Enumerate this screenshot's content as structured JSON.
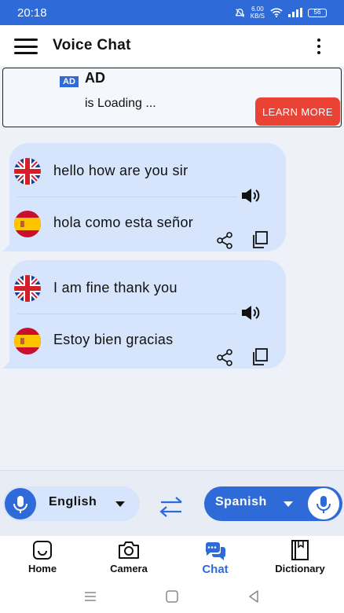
{
  "status_bar": {
    "time": "20:18",
    "net_speed_value": "6.00",
    "net_speed_unit": "KB/S",
    "battery": "56"
  },
  "app_bar": {
    "title": "Voice Chat"
  },
  "ad": {
    "badge": "AD",
    "title": "AD",
    "loading_text": "is Loading ...",
    "cta": "LEARN MORE"
  },
  "messages": [
    {
      "source_text": "hello how are you sir",
      "translated_text": "hola como esta señor"
    },
    {
      "source_text": "I am fine thank you",
      "translated_text": "Estoy bien gracias"
    }
  ],
  "language_bar": {
    "source_language": "English",
    "target_language": "Spanish"
  },
  "bottom_nav": {
    "items": [
      {
        "label": "Home",
        "icon": "home-icon"
      },
      {
        "label": "Camera",
        "icon": "camera-icon"
      },
      {
        "label": "Chat",
        "icon": "chat-icon"
      },
      {
        "label": "Dictionary",
        "icon": "dictionary-icon"
      }
    ],
    "active": "Chat"
  },
  "colors": {
    "primary": "#2f6bd8",
    "bubble": "#d6e5fb",
    "cta": "#ea4335",
    "background": "#eef2f8"
  }
}
